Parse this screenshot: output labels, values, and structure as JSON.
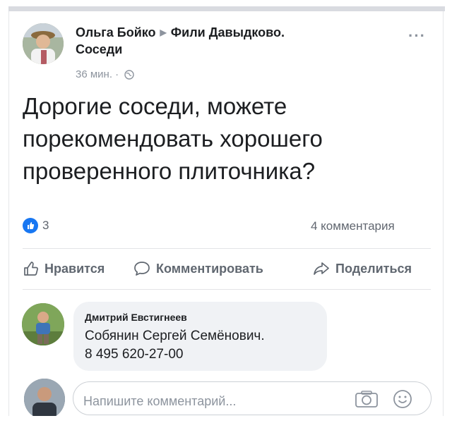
{
  "post": {
    "author": "Ольга Бойко",
    "group": "Фили Давыдково.",
    "group_line2": "Соседи",
    "time": "36 мин. ·",
    "text_lines": [
      "Дорогие соседи, можете",
      "порекомендовать хорошего",
      "проверенного плиточника?"
    ],
    "more_label": "···",
    "likes_count": "3",
    "comments_count": "4 комментария"
  },
  "actions": {
    "like": "Нравится",
    "comment": "Комментировать",
    "share": "Поделиться"
  },
  "comment": {
    "author": "Дмитрий Евстигнеев",
    "line1": "Собянин Сергей Семёнович.",
    "line2": "8 495 620-27-00"
  },
  "composer": {
    "placeholder": "Напишите комментарий..."
  },
  "colors": {
    "accent": "#1877f2",
    "muted": "#8d949e",
    "bubble": "#f0f2f5"
  },
  "icons": [
    "globe-icon",
    "like-thumb-icon",
    "comment-icon",
    "share-icon",
    "camera-icon",
    "emoji-icon",
    "more-icon"
  ]
}
